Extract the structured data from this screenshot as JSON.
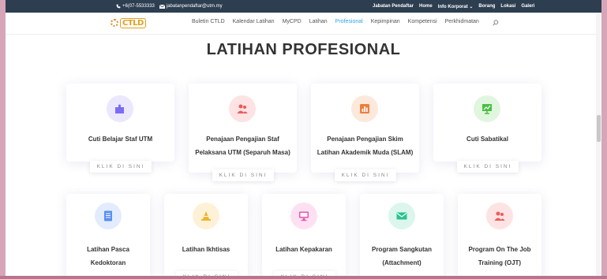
{
  "topbar": {
    "phone": "+6(07-5533333",
    "email": "jabatanpendaftar@utm.my",
    "links": [
      "Jabatan Pendaftar",
      "Home",
      "Info Korporat ⌄",
      "Borang",
      "Lokasi",
      "Galeri"
    ]
  },
  "logo_text": "CTLD",
  "nav": {
    "items": [
      "Buletin CTLD",
      "Kalendar Latihan",
      "MyCPD",
      "Latihan",
      "Profesional",
      "Kepimpinan",
      "Kompetensi",
      "Perkhidmatan"
    ],
    "active": "Profesional"
  },
  "page_title": "LATIHAN PROFESIONAL",
  "button_label": "KLIK DI SINI",
  "row1": [
    {
      "title_lines": [
        "Cuti Belajar Staf UTM"
      ],
      "icon": "puzzle-icon",
      "color": "#7b6cf6",
      "bg": "#ebe8fd"
    },
    {
      "title_lines": [
        "Penajaan Pengajian Staf",
        "Pelaksana UTM (Separuh Masa)"
      ],
      "icon": "users-icon",
      "color": "#ef5a5a",
      "bg": "#fde3e3"
    },
    {
      "title_lines": [
        "Penajaan Pengajian Skim",
        "Latihan Akademik Muda (SLAM)"
      ],
      "icon": "chart-icon",
      "color": "#f07c3c",
      "bg": "#fde8dc"
    },
    {
      "title_lines": [
        "Cuti Sabatikal"
      ],
      "icon": "presentation-icon",
      "color": "#4cbf45",
      "bg": "#e1f6df"
    }
  ],
  "row2": [
    {
      "title_lines": [
        "Latihan Pasca",
        "Kedoktoran"
      ],
      "icon": "document-icon",
      "color": "#5a8ef2",
      "bg": "#e2ecfd"
    },
    {
      "title_lines": [
        "Latihan Ikhtisas"
      ],
      "icon": "cone-icon",
      "color": "#f2b42e",
      "bg": "#fdf2d8"
    },
    {
      "title_lines": [
        "Latihan Kepakaran"
      ],
      "icon": "monitor-icon",
      "color": "#f04fb0",
      "bg": "#fde1f2"
    },
    {
      "title_lines": [
        "Program Sangkutan",
        "(Attachment)"
      ],
      "icon": "mail-icon",
      "color": "#29c38f",
      "bg": "#dcf6ed"
    },
    {
      "title_lines": [
        "Program On The Job",
        "Training (OJT)"
      ],
      "icon": "users-icon",
      "color": "#ef5a5a",
      "bg": "#fde3e3"
    }
  ]
}
